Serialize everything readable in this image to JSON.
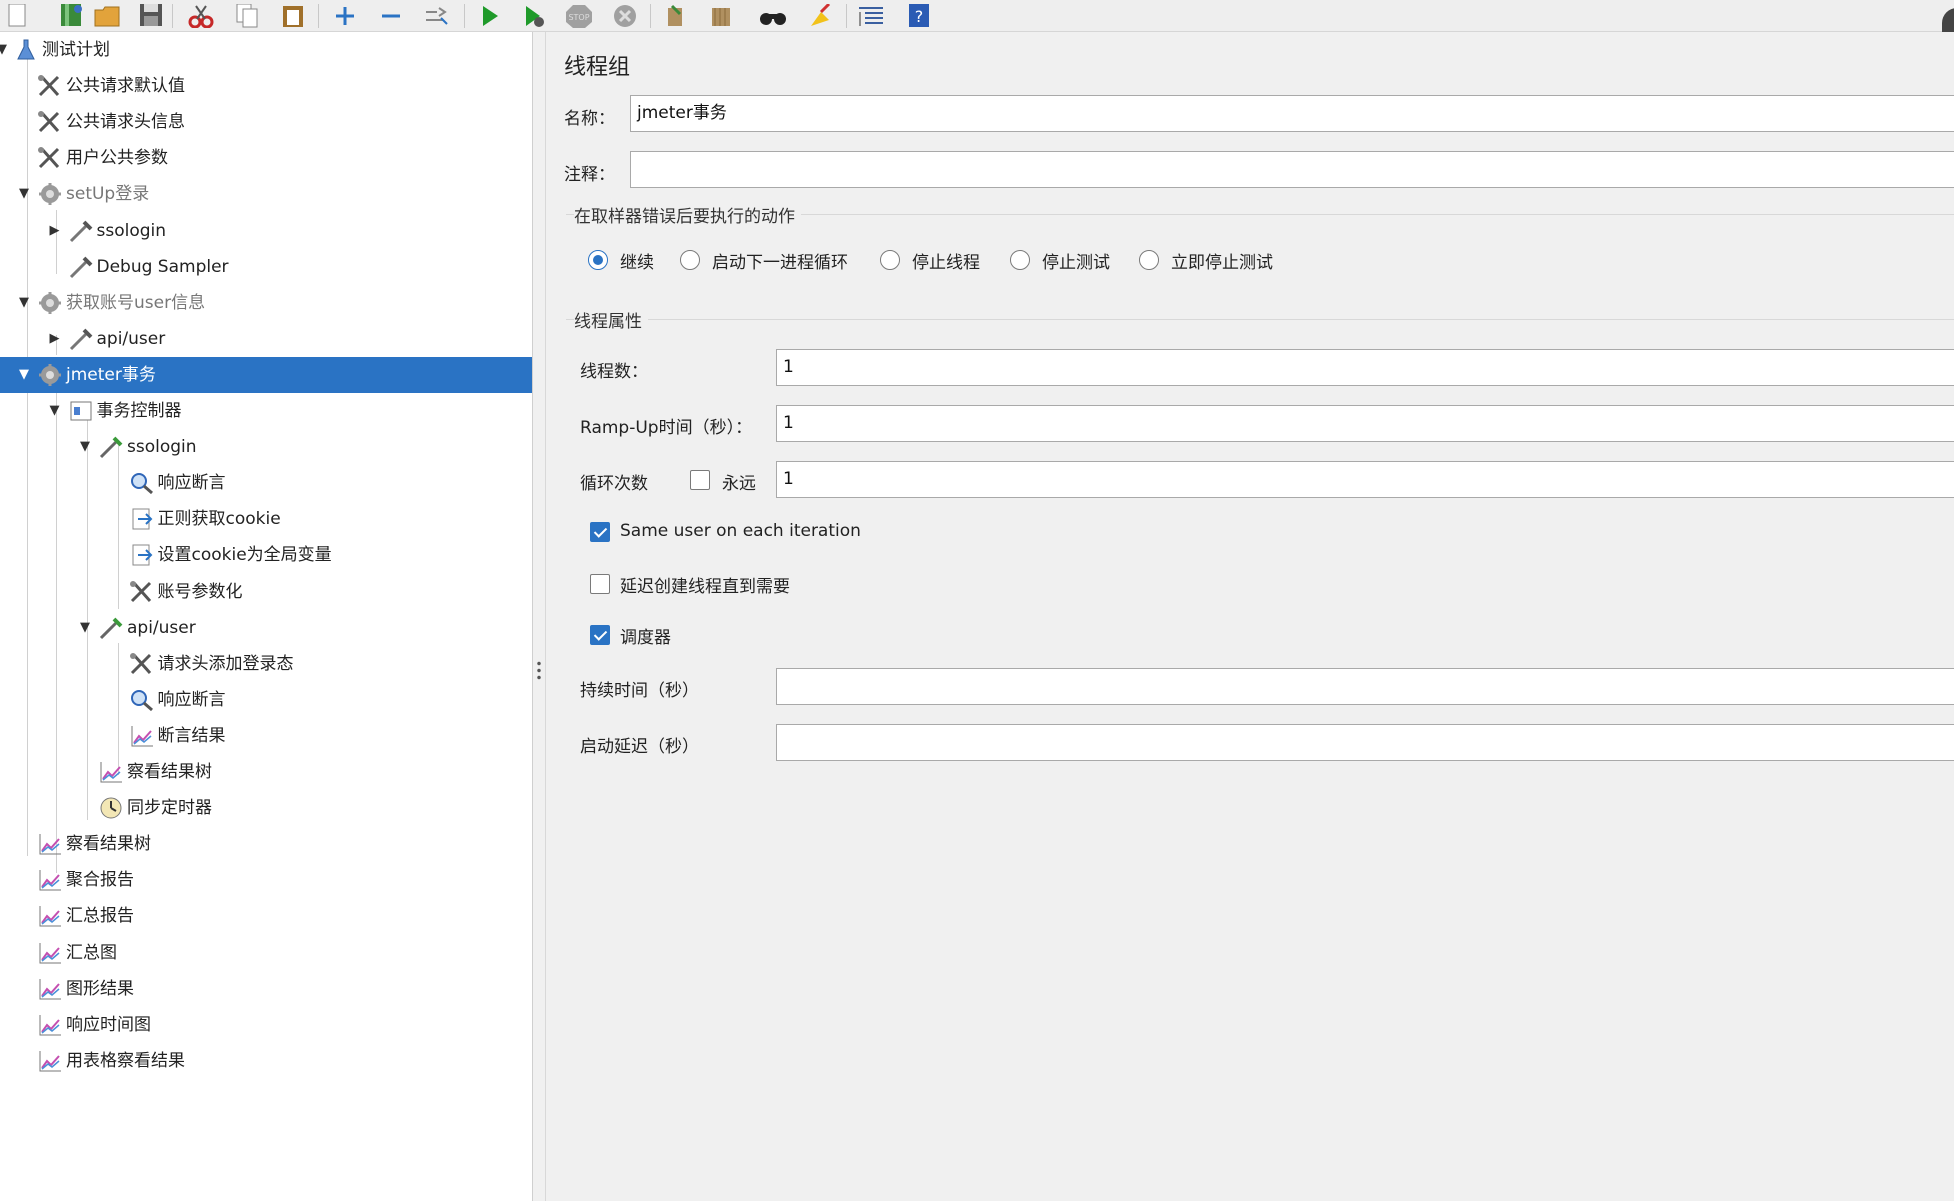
{
  "colors": {
    "accent": "#2a73c4",
    "selection_bg": "#2a73c4",
    "tree_bg": "#ffffff",
    "panel_bg": "#f0f0f0"
  },
  "toolbar": {
    "buttons": [
      {
        "name": "new-icon"
      },
      {
        "name": "templates-icon"
      },
      {
        "name": "open-icon"
      },
      {
        "name": "save-icon"
      },
      {
        "name": "cut-icon"
      },
      {
        "name": "copy-icon"
      },
      {
        "name": "paste-icon"
      },
      {
        "name": "expand-icon"
      },
      {
        "name": "collapse-icon"
      },
      {
        "name": "toggle-icon"
      },
      {
        "name": "start-icon"
      },
      {
        "name": "start-no-pause-icon"
      },
      {
        "name": "stop-icon"
      },
      {
        "name": "shutdown-icon"
      },
      {
        "name": "clear-icon"
      },
      {
        "name": "clear-all-icon"
      },
      {
        "name": "search-icon"
      },
      {
        "name": "reset-search-icon"
      },
      {
        "name": "function-helper-icon"
      },
      {
        "name": "help-icon"
      }
    ],
    "stop_label": "STOP"
  },
  "tree": {
    "nodes": [
      {
        "label": "测试计划",
        "level": 0,
        "arrow": "down",
        "icon": "flask-icon",
        "name": "test-plan"
      },
      {
        "label": "公共请求默认值",
        "level": 1,
        "arrow": "",
        "icon": "wrench-icon",
        "name": "http-defaults"
      },
      {
        "label": "公共请求头信息",
        "level": 1,
        "arrow": "",
        "icon": "wrench-icon",
        "name": "header-manager"
      },
      {
        "label": "用户公共参数",
        "level": 1,
        "arrow": "",
        "icon": "wrench-icon",
        "name": "user-params"
      },
      {
        "label": "setUp登录",
        "level": 1,
        "arrow": "down",
        "icon": "gear-icon",
        "name": "setup-login",
        "disabled": true
      },
      {
        "label": "ssologin",
        "level": 2,
        "arrow": "right",
        "icon": "pipette-icon",
        "name": "setup-ssologin"
      },
      {
        "label": "Debug Sampler",
        "level": 2,
        "arrow": "",
        "icon": "pipette-icon",
        "name": "debug-sampler"
      },
      {
        "label": "获取账号user信息",
        "level": 1,
        "arrow": "down",
        "icon": "gear-icon",
        "name": "get-user-info",
        "disabled": true
      },
      {
        "label": "api/user",
        "level": 2,
        "arrow": "right",
        "icon": "pipette-icon",
        "name": "getinfo-api-user"
      },
      {
        "label": "jmeter事务",
        "level": 1,
        "arrow": "down",
        "icon": "gear-icon",
        "name": "jmeter-transaction",
        "selected": true
      },
      {
        "label": "事务控制器",
        "level": 2,
        "arrow": "down",
        "icon": "controller-icon",
        "name": "transaction-controller"
      },
      {
        "label": "ssologin",
        "level": 3,
        "arrow": "down",
        "icon": "pipette-green-icon",
        "name": "tc-ssologin"
      },
      {
        "label": "响应断言",
        "level": 4,
        "arrow": "",
        "icon": "magnifier-icon",
        "name": "response-assertion-1"
      },
      {
        "label": "正则获取cookie",
        "level": 4,
        "arrow": "",
        "icon": "doc-arrow-icon",
        "name": "regex-cookie"
      },
      {
        "label": "设置cookie为全局变量",
        "level": 4,
        "arrow": "",
        "icon": "doc-arrow-icon",
        "name": "set-cookie-global"
      },
      {
        "label": "账号参数化",
        "level": 4,
        "arrow": "",
        "icon": "wrench-icon",
        "name": "account-params"
      },
      {
        "label": "api/user",
        "level": 3,
        "arrow": "down",
        "icon": "pipette-green-icon",
        "name": "tc-api-user"
      },
      {
        "label": "请求头添加登录态",
        "level": 4,
        "arrow": "",
        "icon": "wrench-icon",
        "name": "header-login-state"
      },
      {
        "label": "响应断言",
        "level": 4,
        "arrow": "",
        "icon": "magnifier-icon",
        "name": "response-assertion-2"
      },
      {
        "label": "断言结果",
        "level": 4,
        "arrow": "",
        "icon": "graph-icon",
        "name": "assertion-results"
      },
      {
        "label": "察看结果树",
        "level": 3,
        "arrow": "",
        "icon": "graph-icon",
        "name": "view-results-tree-inner"
      },
      {
        "label": "同步定时器",
        "level": 3,
        "arrow": "",
        "icon": "timer-icon",
        "name": "sync-timer"
      },
      {
        "label": "察看结果树",
        "level": 1,
        "arrow": "",
        "icon": "graph-icon",
        "name": "view-results-tree"
      },
      {
        "label": "聚合报告",
        "level": 1,
        "arrow": "",
        "icon": "graph-icon",
        "name": "aggregate-report"
      },
      {
        "label": "汇总报告",
        "level": 1,
        "arrow": "",
        "icon": "graph-icon",
        "name": "summary-report"
      },
      {
        "label": "汇总图",
        "level": 1,
        "arrow": "",
        "icon": "graph-icon",
        "name": "aggregate-graph"
      },
      {
        "label": "图形结果",
        "level": 1,
        "arrow": "",
        "icon": "graph-icon",
        "name": "graph-results"
      },
      {
        "label": "响应时间图",
        "level": 1,
        "arrow": "",
        "icon": "graph-icon",
        "name": "response-time-graph"
      },
      {
        "label": "用表格察看结果",
        "level": 1,
        "arrow": "",
        "icon": "graph-icon",
        "name": "view-results-table"
      }
    ]
  },
  "form": {
    "title": "线程组",
    "name_label": "名称：",
    "name_value": "jmeter事务",
    "comment_label": "注释：",
    "comment_value": "",
    "error_action": {
      "title": "在取样器错误后要执行的动作",
      "options": [
        {
          "label": "继续",
          "selected": true
        },
        {
          "label": "启动下一进程循环",
          "selected": false
        },
        {
          "label": "停止线程",
          "selected": false
        },
        {
          "label": "停止测试",
          "selected": false
        },
        {
          "label": "立即停止测试",
          "selected": false
        }
      ]
    },
    "thread_props": {
      "title": "线程属性",
      "threads_label": "线程数：",
      "threads_value": "1",
      "rampup_label": "Ramp-Up时间（秒）：",
      "rampup_value": "1",
      "loop_label": "循环次数",
      "forever_label": "永远",
      "forever_checked": false,
      "loop_value": "1",
      "same_user_label": "Same user on each iteration",
      "same_user_checked": true,
      "delay_label": "延迟创建线程直到需要",
      "delay_checked": false,
      "scheduler_label": "调度器",
      "scheduler_checked": true,
      "duration_label": "持续时间（秒）",
      "duration_value": "",
      "startup_delay_label": "启动延迟（秒）",
      "startup_delay_value": ""
    }
  }
}
